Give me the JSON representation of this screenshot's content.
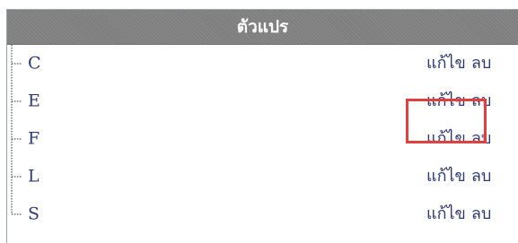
{
  "header": {
    "title": "ตัวแปร"
  },
  "variables": [
    {
      "name": "C",
      "edit_label": "แก้ไข",
      "delete_label": "ลบ"
    },
    {
      "name": "E",
      "edit_label": "แก้ไข",
      "delete_label": "ลบ"
    },
    {
      "name": "F",
      "edit_label": "แก้ไข",
      "delete_label": "ลบ"
    },
    {
      "name": "L",
      "edit_label": "แก้ไข",
      "delete_label": "ลบ"
    },
    {
      "name": "S",
      "edit_label": "แก้ไข",
      "delete_label": "ลบ"
    }
  ],
  "colors": {
    "header_bg": "#7f7f7f",
    "text": "#2e3a73",
    "highlight": "#e0403f"
  },
  "highlight": {
    "target": "variables.1.edit"
  }
}
